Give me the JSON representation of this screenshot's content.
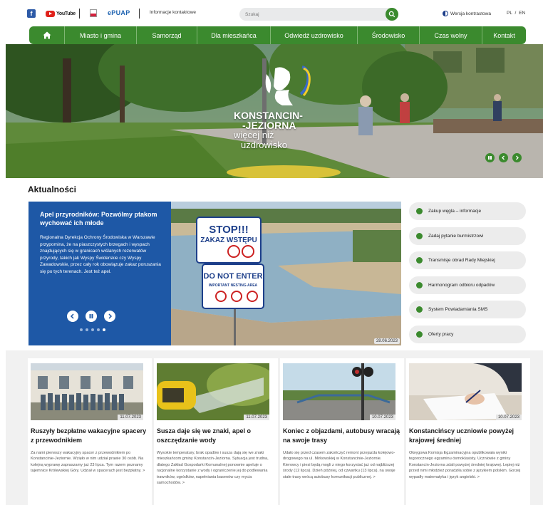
{
  "topbar": {
    "facebook_label": "f",
    "youtube_label": "YouTube",
    "epuap_label": "ePUAP",
    "info_link": "Informacje kontaktowe",
    "search_placeholder": "Szukaj",
    "contrast_label": "Wersja kontrastowa",
    "lang": "PL / EN"
  },
  "nav": {
    "home_icon": "home-icon",
    "items": [
      "Miasto i gmina",
      "Samorząd",
      "Dla mieszkańca",
      "Odwiedź uzdrowisko",
      "Środowisko",
      "Czas wolny",
      "Kontakt"
    ]
  },
  "hero": {
    "line1": "KONSTANCIN-",
    "line2": "-JEZIORNA",
    "line3": "więcej niż",
    "line4": "uzdrowisko"
  },
  "news": {
    "section_title": "Aktualności",
    "slide": {
      "title": "Apel przyrodników: Pozwólmy ptakom wychować ich młode",
      "body": "Regionalna Dyrekcja Ochrony Środowiska w Warszawie przypomina, że na piaszczystych brzegach i wyspach znajdujących się w granicach wiślanych rezerwatów przyrody, takich jak Wyspy Świderskie czy Wyspy Zawadowskie, przez cały rok obowiązuje zakaz poruszania się po tych terenach. Jest też apel.",
      "date": "28.06.2023",
      "sign1_title": "STOP!!!",
      "sign1_sub": "ZAKAZ WSTĘPU",
      "sign2_title": "DO NOT ENTER",
      "sign2_sub": "IMPORTANT NESTING AREA"
    },
    "quick_links": [
      "Zakup węgla – informacje",
      "Zadaj pytanie burmistrzowi",
      "Transmisje obrad Rady Miejskiej",
      "Harmonogram odbioru odpadów",
      "System Powiadamiania SMS",
      "Oferty pracy"
    ]
  },
  "cards": [
    {
      "date": "11.07.2023",
      "title": "Ruszyły bezpłatne wakacyjne spacery z przewodnikiem",
      "excerpt": "Za nami pierwszy wakacyjny spacer z przewodnikiem po Konstancinie-Jeziornie. Wzięło w nim udział prawie 30 osób. Na kolejną wyprawę zapraszamy już 23 lipca. Tym razem poznamy tajemnice Królewskiej Góry. Udział w spacerach jest bezpłatny.  >"
    },
    {
      "date": "11.07.2023",
      "title": "Susza daje się we znaki, apel o oszczędzanie wody",
      "excerpt": "Wysokie temperatury, brak opadów i susza dają się we znaki mieszkańcom gminy Konstancin-Jeziorna. Sytuacja jest trudna, dlatego Zakład Gospodarki Komunalnej ponownie apeluje o racjonalne korzystanie z wody i ograniczenie jej do podlewania trawników, ogródków, napełniania basenów czy mycia samochodów.  >"
    },
    {
      "date": "10.07.2023",
      "title": "Koniec z objazdami, autobusy wracają na swoje trasy",
      "excerpt": "Udało się przed czasem zakończyć remont przejazdu kolejowo-drogowego na ul. Mirkowskiej w Konstancinie-Jeziornie. Kierowcy i piesi będą mogli z niego korzystać już od najbliższej środy (12 lipca). Dzień później, od czwartku (13 lipca), na swoje stałe trasy wrócą autobusy komunikacji publicznej.  >"
    },
    {
      "date": "10.07.2023",
      "title": "Konstancińscy uczniowie powyżej krajowej średniej",
      "excerpt": "Okręgowa Komisja Egzaminacyjna opublikowała wyniki tegorocznego egzaminu ósmoklasisty. Uczniowie z gminy Konstancin-Jeziorna zdali powyżej średniej krajowej. Lepiej niż przed nimi młodzież poradziła sobie z językiem polskim. Gorzej wypadły matematyka i język angielski.  >"
    }
  ],
  "colors": {
    "green": "#3b8a2e",
    "blue": "#1e58a6"
  }
}
